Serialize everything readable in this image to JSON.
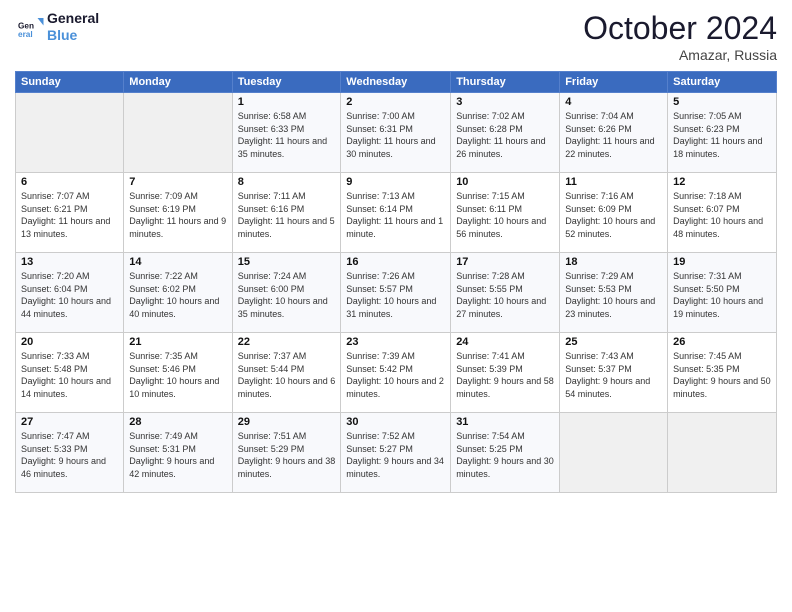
{
  "logo": {
    "line1": "General",
    "line2": "Blue"
  },
  "title": "October 2024",
  "location": "Amazar, Russia",
  "weekdays": [
    "Sunday",
    "Monday",
    "Tuesday",
    "Wednesday",
    "Thursday",
    "Friday",
    "Saturday"
  ],
  "weeks": [
    [
      {
        "day": "",
        "info": ""
      },
      {
        "day": "",
        "info": ""
      },
      {
        "day": "1",
        "info": "Sunrise: 6:58 AM\nSunset: 6:33 PM\nDaylight: 11 hours and 35 minutes."
      },
      {
        "day": "2",
        "info": "Sunrise: 7:00 AM\nSunset: 6:31 PM\nDaylight: 11 hours and 30 minutes."
      },
      {
        "day": "3",
        "info": "Sunrise: 7:02 AM\nSunset: 6:28 PM\nDaylight: 11 hours and 26 minutes."
      },
      {
        "day": "4",
        "info": "Sunrise: 7:04 AM\nSunset: 6:26 PM\nDaylight: 11 hours and 22 minutes."
      },
      {
        "day": "5",
        "info": "Sunrise: 7:05 AM\nSunset: 6:23 PM\nDaylight: 11 hours and 18 minutes."
      }
    ],
    [
      {
        "day": "6",
        "info": "Sunrise: 7:07 AM\nSunset: 6:21 PM\nDaylight: 11 hours and 13 minutes."
      },
      {
        "day": "7",
        "info": "Sunrise: 7:09 AM\nSunset: 6:19 PM\nDaylight: 11 hours and 9 minutes."
      },
      {
        "day": "8",
        "info": "Sunrise: 7:11 AM\nSunset: 6:16 PM\nDaylight: 11 hours and 5 minutes."
      },
      {
        "day": "9",
        "info": "Sunrise: 7:13 AM\nSunset: 6:14 PM\nDaylight: 11 hours and 1 minute."
      },
      {
        "day": "10",
        "info": "Sunrise: 7:15 AM\nSunset: 6:11 PM\nDaylight: 10 hours and 56 minutes."
      },
      {
        "day": "11",
        "info": "Sunrise: 7:16 AM\nSunset: 6:09 PM\nDaylight: 10 hours and 52 minutes."
      },
      {
        "day": "12",
        "info": "Sunrise: 7:18 AM\nSunset: 6:07 PM\nDaylight: 10 hours and 48 minutes."
      }
    ],
    [
      {
        "day": "13",
        "info": "Sunrise: 7:20 AM\nSunset: 6:04 PM\nDaylight: 10 hours and 44 minutes."
      },
      {
        "day": "14",
        "info": "Sunrise: 7:22 AM\nSunset: 6:02 PM\nDaylight: 10 hours and 40 minutes."
      },
      {
        "day": "15",
        "info": "Sunrise: 7:24 AM\nSunset: 6:00 PM\nDaylight: 10 hours and 35 minutes."
      },
      {
        "day": "16",
        "info": "Sunrise: 7:26 AM\nSunset: 5:57 PM\nDaylight: 10 hours and 31 minutes."
      },
      {
        "day": "17",
        "info": "Sunrise: 7:28 AM\nSunset: 5:55 PM\nDaylight: 10 hours and 27 minutes."
      },
      {
        "day": "18",
        "info": "Sunrise: 7:29 AM\nSunset: 5:53 PM\nDaylight: 10 hours and 23 minutes."
      },
      {
        "day": "19",
        "info": "Sunrise: 7:31 AM\nSunset: 5:50 PM\nDaylight: 10 hours and 19 minutes."
      }
    ],
    [
      {
        "day": "20",
        "info": "Sunrise: 7:33 AM\nSunset: 5:48 PM\nDaylight: 10 hours and 14 minutes."
      },
      {
        "day": "21",
        "info": "Sunrise: 7:35 AM\nSunset: 5:46 PM\nDaylight: 10 hours and 10 minutes."
      },
      {
        "day": "22",
        "info": "Sunrise: 7:37 AM\nSunset: 5:44 PM\nDaylight: 10 hours and 6 minutes."
      },
      {
        "day": "23",
        "info": "Sunrise: 7:39 AM\nSunset: 5:42 PM\nDaylight: 10 hours and 2 minutes."
      },
      {
        "day": "24",
        "info": "Sunrise: 7:41 AM\nSunset: 5:39 PM\nDaylight: 9 hours and 58 minutes."
      },
      {
        "day": "25",
        "info": "Sunrise: 7:43 AM\nSunset: 5:37 PM\nDaylight: 9 hours and 54 minutes."
      },
      {
        "day": "26",
        "info": "Sunrise: 7:45 AM\nSunset: 5:35 PM\nDaylight: 9 hours and 50 minutes."
      }
    ],
    [
      {
        "day": "27",
        "info": "Sunrise: 7:47 AM\nSunset: 5:33 PM\nDaylight: 9 hours and 46 minutes."
      },
      {
        "day": "28",
        "info": "Sunrise: 7:49 AM\nSunset: 5:31 PM\nDaylight: 9 hours and 42 minutes."
      },
      {
        "day": "29",
        "info": "Sunrise: 7:51 AM\nSunset: 5:29 PM\nDaylight: 9 hours and 38 minutes."
      },
      {
        "day": "30",
        "info": "Sunrise: 7:52 AM\nSunset: 5:27 PM\nDaylight: 9 hours and 34 minutes."
      },
      {
        "day": "31",
        "info": "Sunrise: 7:54 AM\nSunset: 5:25 PM\nDaylight: 9 hours and 30 minutes."
      },
      {
        "day": "",
        "info": ""
      },
      {
        "day": "",
        "info": ""
      }
    ]
  ]
}
